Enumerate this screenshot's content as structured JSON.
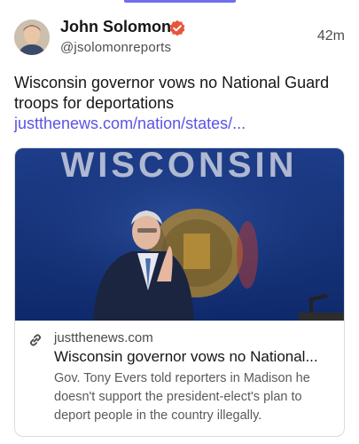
{
  "app": {
    "accent": "#6f6ff0",
    "link_color": "#5b53e6",
    "verified_color": "#e8553a"
  },
  "post": {
    "author": {
      "name": "John Solomon",
      "handle": "@jsolomonreports",
      "verified_icon": "verified-badge-icon"
    },
    "timestamp": "42m",
    "text": "Wisconsin governor vows no National Guard troops for deportations ",
    "link_text": "justthenews.com/nation/states/..."
  },
  "card": {
    "image_text": "WISCONSIN",
    "domain": "justthenews.com",
    "title": "Wisconsin governor vows no National...",
    "description": "Gov. Tony Evers told reporters in Madison he doesn't support the president-elect's plan to deport people in the country illegally.",
    "link_icon": "link-icon"
  }
}
